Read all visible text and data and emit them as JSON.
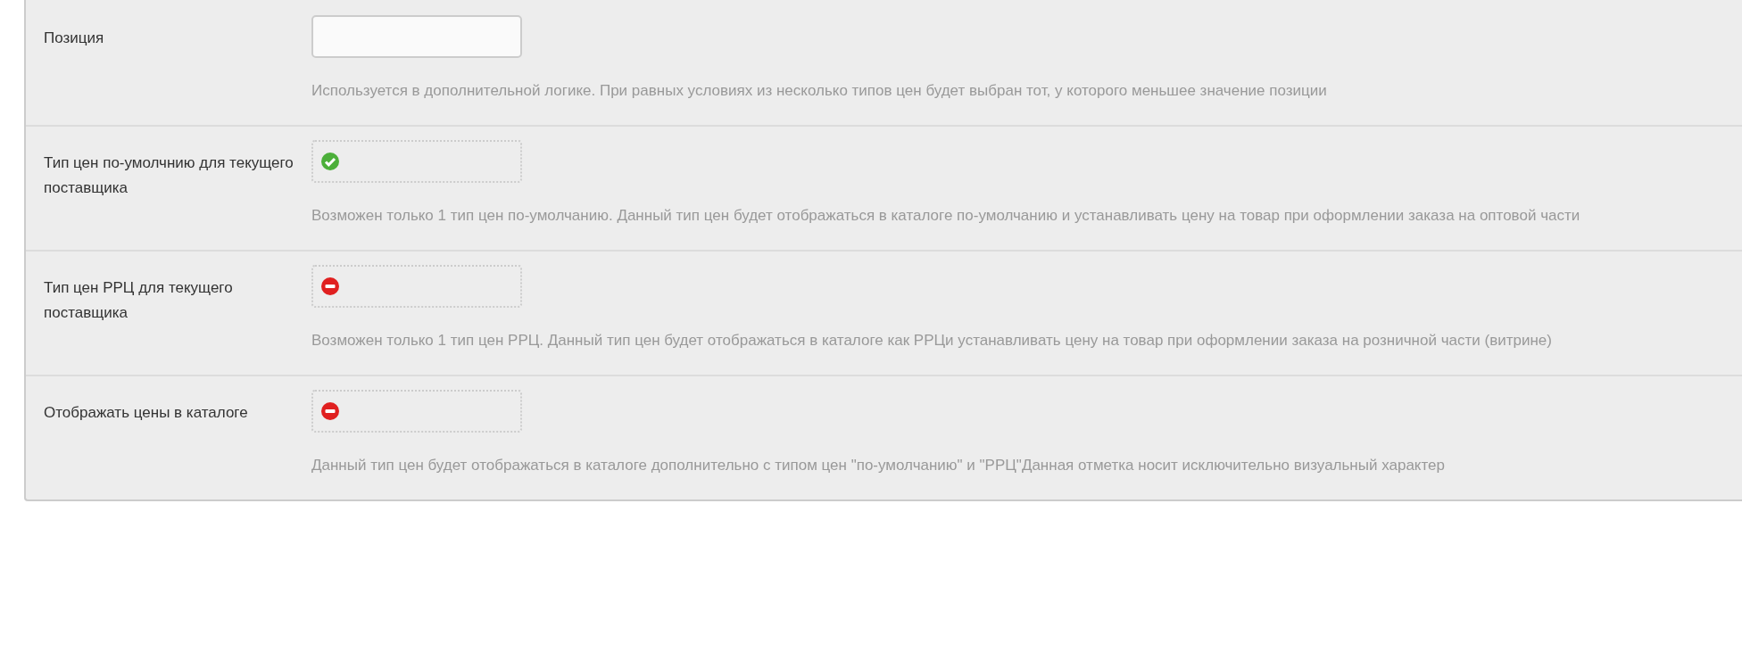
{
  "rows": [
    {
      "label": "Позиция",
      "field": {
        "kind": "text"
      },
      "help": "Используется в дополнительной логике. При равных условиях из несколько типов цен будет выбран тот, у которого меньшее значение позиции"
    },
    {
      "label": "Тип цен по-умолчнию для текущего поставщика",
      "field": {
        "kind": "toggle",
        "on": true
      },
      "help": "Возможен только 1 тип цен по-умолчанию. Данный тип цен будет отображаться в каталоге по-умолчанию и устанавливать цену на товар при оформлении заказа на оптовой части"
    },
    {
      "label": "Тип цен РРЦ для текущего поставщика",
      "field": {
        "kind": "toggle",
        "on": false
      },
      "help": "Возможен только 1 тип цен РРЦ. Данный тип цен будет отображаться в каталоге как РРЦи устанавливать цену на товар при оформлении заказа на розничной части (витрине)"
    },
    {
      "label": "Отображать цены в каталоге",
      "field": {
        "kind": "toggle",
        "on": false
      },
      "help": "Данный тип цен будет отображаться в каталоге дополнительно с типом цен \"по-умолчанию\" и \"РРЦ\"Данная отметка носит исключительно визуальный характер"
    }
  ]
}
